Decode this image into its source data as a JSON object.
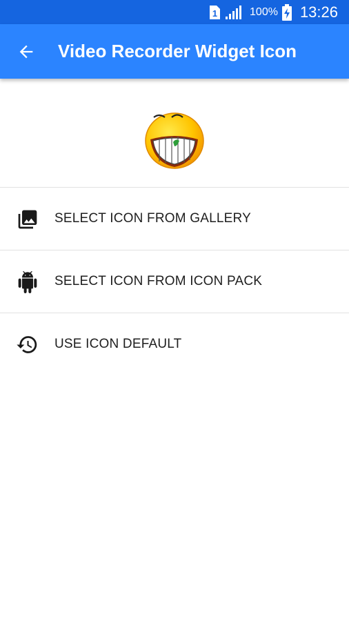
{
  "status_bar": {
    "sim_label": "1",
    "battery_percent": "100%",
    "time": "13:26",
    "icons": [
      "sim-icon",
      "signal-icon",
      "battery-charging-icon"
    ]
  },
  "app_bar": {
    "back_icon": "arrow-left-icon",
    "title": "Video Recorder Widget Icon",
    "color": "#2b84ff",
    "status_color": "#1565e0"
  },
  "preview": {
    "icon": "grinning-emoji-icon"
  },
  "menu": {
    "items": [
      {
        "label": "SELECT ICON FROM GALLERY",
        "icon": "photo-library-icon"
      },
      {
        "label": "SELECT ICON FROM ICON PACK",
        "icon": "android-icon"
      },
      {
        "label": "USE ICON DEFAULT",
        "icon": "history-icon"
      }
    ]
  }
}
